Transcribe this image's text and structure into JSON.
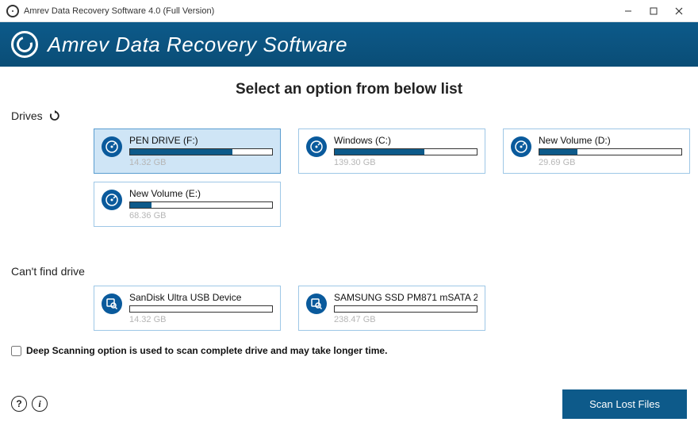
{
  "window": {
    "title": "Amrev Data Recovery Software 4.0 (Full Version)"
  },
  "header": {
    "title": "Amrev Data Recovery Software"
  },
  "pageTitle": "Select an option from below list",
  "sections": {
    "drives": "Drives",
    "devices": "Can't find drive"
  },
  "drives": [
    {
      "name": "PEN DRIVE (F:)",
      "size": "14.32 GB",
      "fillPct": 72,
      "selected": true
    },
    {
      "name": "Windows (C:)",
      "size": "139.30 GB",
      "fillPct": 63,
      "selected": false
    },
    {
      "name": "New Volume (D:)",
      "size": "29.69 GB",
      "fillPct": 27,
      "selected": false
    },
    {
      "name": "New Volume (E:)",
      "size": "68.36 GB",
      "fillPct": 15,
      "selected": false
    }
  ],
  "devices": [
    {
      "name": "SanDisk Ultra USB Device",
      "size": "14.32 GB"
    },
    {
      "name": "SAMSUNG SSD PM871 mSATA 2",
      "size": "238.47 GB"
    }
  ],
  "deepScan": {
    "checked": false,
    "label": "Deep Scanning option is used to scan complete drive and may take longer time."
  },
  "footer": {
    "scan": "Scan Lost Files"
  }
}
